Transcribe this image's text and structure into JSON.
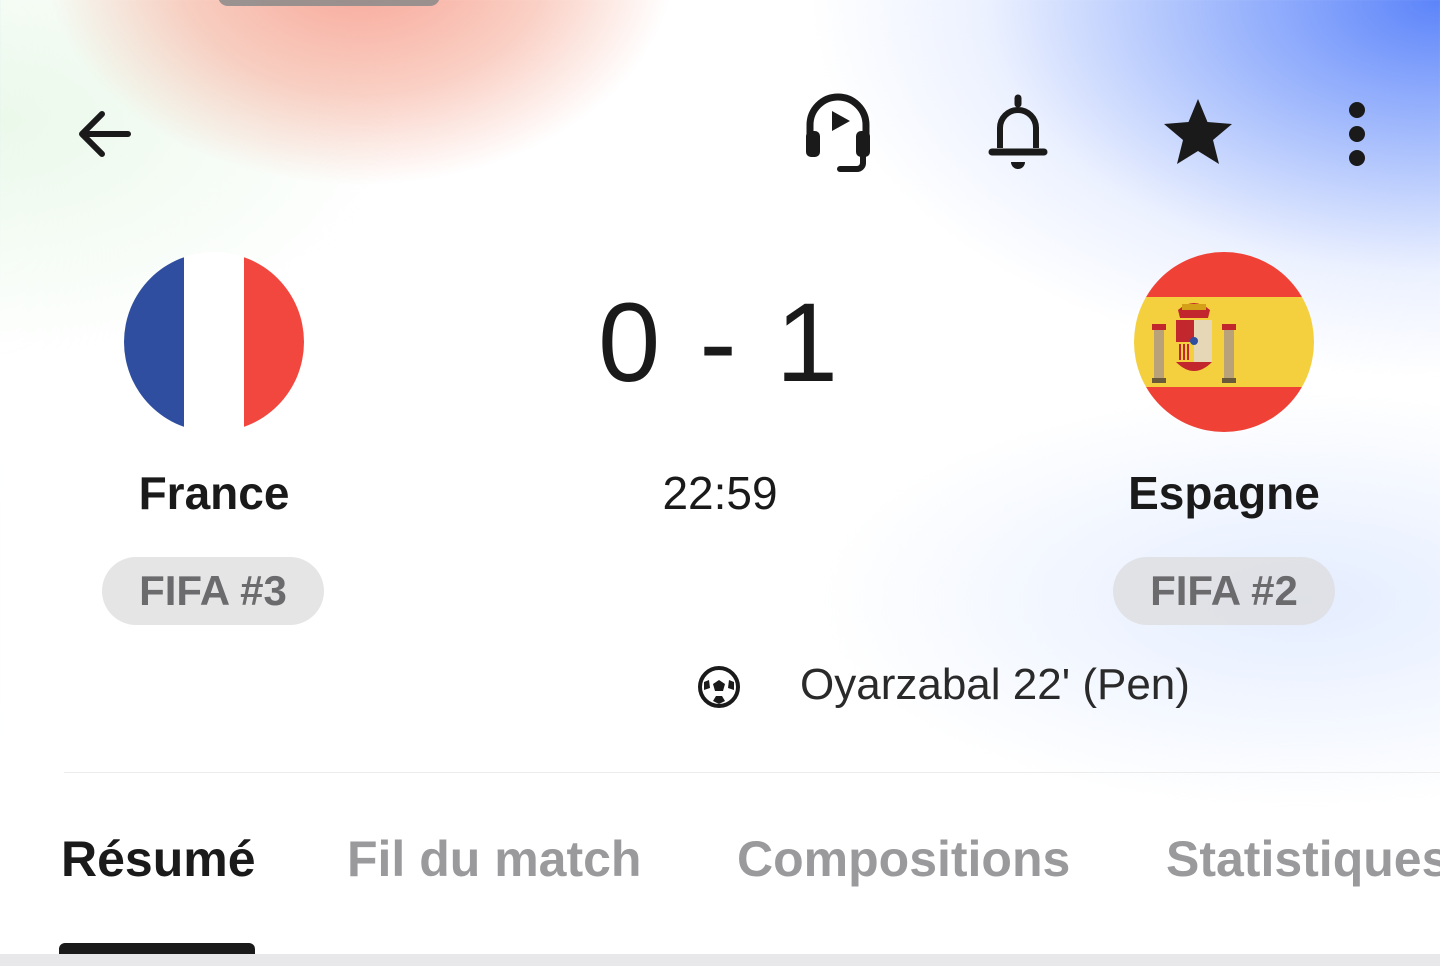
{
  "header": {
    "icons": [
      "back-arrow-icon",
      "live-audio-icon",
      "bell-icon",
      "star-icon",
      "more-vertical-icon"
    ]
  },
  "match": {
    "home": {
      "name": "France",
      "rank": "FIFA #3",
      "flag_colors": [
        "#2f4ea0",
        "#ffffff",
        "#f2473f"
      ]
    },
    "away": {
      "name": "Espagne",
      "rank": "FIFA #2",
      "flag_colors": [
        "#ef4136",
        "#f4d03f"
      ]
    },
    "score": "0 - 1",
    "clock": "22:59",
    "goals": [
      {
        "icon": "soccer-ball-icon",
        "text": "Oyarzabal 22' (Pen)"
      }
    ]
  },
  "tabs": [
    {
      "label": "Résumé",
      "active": true
    },
    {
      "label": "Fil du match",
      "active": false
    },
    {
      "label": "Compositions",
      "active": false
    },
    {
      "label": "Statistiques",
      "active": false
    }
  ]
}
